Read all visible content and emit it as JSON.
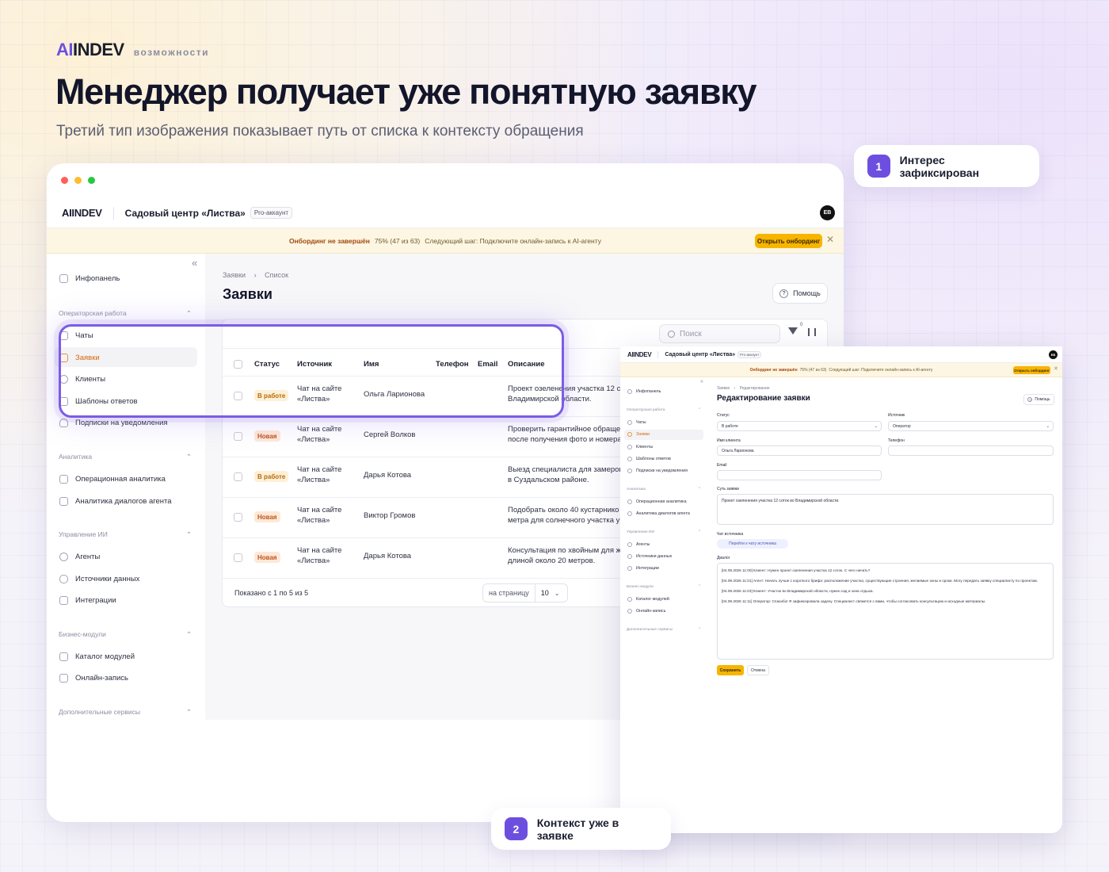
{
  "header": {
    "logo_ai": "AI",
    "logo_rest": "INDEV",
    "tag": "возможности",
    "title": "Менеджер получает уже понятную заявку",
    "subtitle": "Третий тип изображения показывает путь от списка к контексту обращения"
  },
  "callouts": [
    {
      "num": "1",
      "label": "Интерес зафиксирован"
    },
    {
      "num": "2",
      "label": "Контекст уже в заявке"
    }
  ],
  "app": {
    "logo_ai": "AI",
    "logo_rest": "INDEV",
    "org": "Садовый центр «Листва»",
    "plan": "Pro-аккаунт",
    "avatar": "ЕВ",
    "banner": {
      "title": "Онбординг не завершён",
      "progress": "75% (47 из 63)",
      "next": "Следующий шаг: Подключите онлайн-запись к AI-агенту",
      "button": "Открыть онбординг",
      "close": "✕"
    },
    "sidebar": {
      "collapse": "«",
      "home": "Инфопанель",
      "sections": [
        {
          "title": "Операторская работа",
          "items": [
            "Чаты",
            "Заявки",
            "Клиенты",
            "Шаблоны ответов",
            "Подписки на уведомления"
          ]
        },
        {
          "title": "Аналитика",
          "items": [
            "Операционная аналитика",
            "Аналитика диалогов агента"
          ]
        },
        {
          "title": "Управление ИИ",
          "items": [
            "Агенты",
            "Источники данных",
            "Интеграции"
          ]
        },
        {
          "title": "Бизнес-модули",
          "items": [
            "Каталог модулей",
            "Онлайн-запись"
          ]
        },
        {
          "title": "Дополнительные сервисы",
          "items": []
        }
      ]
    }
  },
  "list_page": {
    "breadcrumb": [
      "Заявки",
      "Список"
    ],
    "title": "Заявки",
    "help": "Помощь",
    "search_placeholder": "Поиск",
    "filter_count": "0",
    "columns": [
      "Статус",
      "Источник",
      "Имя",
      "Телефон",
      "Email",
      "Описание"
    ],
    "rows": [
      {
        "status": "В работе",
        "kind": "work",
        "source1": "Чат на сайте",
        "source2": "«Листва»",
        "name": "Ольга Ларионова",
        "desc1": "Проект озеленения участка 12 со",
        "desc2": "Владимирской области."
      },
      {
        "status": "Новая",
        "kind": "new",
        "source1": "Чат на сайте",
        "source2": "«Листва»",
        "name": "Сергей Волков",
        "desc1": "Проверить гарантийное обращен",
        "desc2": "после получения фото и номера"
      },
      {
        "status": "В работе",
        "kind": "work",
        "source1": "Чат на сайте",
        "source2": "«Листва»",
        "name": "Дарья Котова",
        "desc1": "Выезд специалиста для замеров",
        "desc2": "в Суздальском районе."
      },
      {
        "status": "Новая",
        "kind": "new",
        "source1": "Чат на сайте",
        "source2": "«Листва»",
        "name": "Виктор Громов",
        "desc1": "Подобрать около 40 кустарнико",
        "desc2": "метра для солнечного участка у"
      },
      {
        "status": "Новая",
        "kind": "new",
        "source1": "Чат на сайте",
        "source2": "«Листва»",
        "name": "Дарья Котова",
        "desc1": "Консультация по хвойным для ж",
        "desc2": "длиной около 20 метров."
      }
    ],
    "footer": "Показано с 1 по 5 из 5",
    "per_page_label": "на страницу",
    "per_page_value": "10"
  },
  "edit_page": {
    "breadcrumb": [
      "Заявки",
      "Редактирование"
    ],
    "title": "Редактирование заявки",
    "help": "Помощь",
    "status_label": "Статус",
    "status_value": "В работе",
    "source_label": "Источник",
    "source_value": "Оператор",
    "name_label": "Имя клиента",
    "name_value": "Ольга Ларионова",
    "phone_label": "Телефон",
    "email_label": "Email",
    "essence_label": "Суть заявки",
    "essence_value": "Проект озеленения участка 12 соток во Владимирской области.",
    "chat_label": "Чат источника",
    "chat_link": "Перейти к чату источника",
    "dialog_label": "Диалог",
    "dialog": [
      "[04.09.2026 11:00] Клиент: Нужен проект озеленения участка 12 соток. С чего начать?",
      "[04.09.2026 11:01] Агент: Начать лучше с короткого брифа: расположение участка, существующие строения, желаемые зоны и сроки. Могу передать заявку специалисту по проектам.",
      "[04.09.2026 11:03] Клиент: Участок во Владимирской области, нужен сад и зона отдыха.",
      "[04.09.2026 11:11] Оператор: Спасибо! Я зафиксировала задачу. Специалист свяжется с вами, чтобы согласовать консультацию и исходные материалы."
    ],
    "save": "Сохранить",
    "cancel": "Отмена"
  }
}
